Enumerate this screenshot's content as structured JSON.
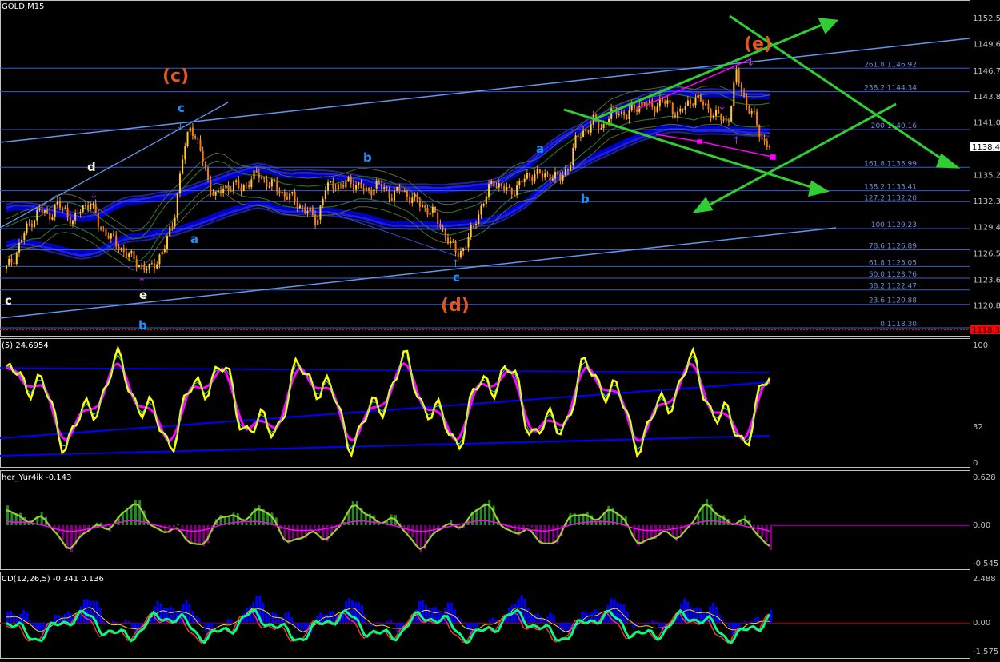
{
  "symbol_label": "GOLD,M15",
  "colors": {
    "background": "#000000",
    "grid_border": "#c0c0c0",
    "fib_line": "#4169e1",
    "trend_line": "#6495ed",
    "channel_green": "#32cd32",
    "triangle_magenta": "#ff00ff",
    "wave_orange": "#e2561f",
    "wave_blue": "#1e90ff",
    "wave_white": "#f5f5dc",
    "price_line": "#ff0000",
    "candle_up": "#ff9900",
    "candle_down": "#ffa040",
    "stoch_main": "#ffff00",
    "stoch_signal": "#ff00ff",
    "osc_pos": "#228b22",
    "osc_neg": "#800080",
    "macd_hist": "#0000ff",
    "macd_line": "#00ff7f"
  },
  "main_panel": {
    "price_axis": [
      "1152.50",
      "1149.65",
      "1146.70",
      "1143.85",
      "1141.00",
      "1138.48",
      "1135.20",
      "1132.30",
      "1129.45",
      "1126.55",
      "1123.65",
      "1120.80",
      "1118.30"
    ],
    "current_price_tag": "1138.48",
    "bottom_price_tag": "1118.30",
    "fib_levels": [
      {
        "label": "261.8 1146.92"
      },
      {
        "label": "238.2 1144.34"
      },
      {
        "label": "200 1140.16"
      },
      {
        "label": "161.8 1135.99"
      },
      {
        "label": "138.2 1133.41"
      },
      {
        "label": "127.2 1132.20"
      },
      {
        "label": "100 1129.23"
      },
      {
        "label": "78.6 1126.89"
      },
      {
        "label": "61.8 1125.05"
      },
      {
        "label": "50.0 1123.76"
      },
      {
        "label": "38.2 1122.47"
      },
      {
        "label": "23.6 1120.88"
      },
      {
        "label": "0 1118.30"
      }
    ],
    "wave_labels": {
      "c_major": "(c)",
      "d_major": "(d)",
      "e_major": "(e)",
      "c_minor_1": "c",
      "d_minor": "d",
      "e_minor": "e",
      "c_minor_white": "c",
      "a_minor_1": "a",
      "b_minor_1": "b",
      "b_minor_2": "b",
      "c_minor_2": "c",
      "a_minor_2": "a",
      "b_minor_3": "b"
    }
  },
  "stoch_panel": {
    "label": "(5) 24.6954",
    "axis": [
      "100",
      "32",
      "0"
    ]
  },
  "osc_panel": {
    "label": "her_Yur4ik -0.143",
    "axis": [
      "0.628",
      "0.00",
      "-0.545"
    ]
  },
  "macd_panel": {
    "label": "CD(12,26,5) -0.341 0.136",
    "axis": [
      "2.488",
      "0.00",
      "-1.575"
    ]
  },
  "chart_data": {
    "type": "line",
    "title": "GOLD,M15",
    "ylim": [
      1118.3,
      1152.5
    ],
    "close_path": [
      1124.8,
      1126.2,
      1128.5,
      1130.1,
      1131.3,
      1130.6,
      1131.8,
      1131.2,
      1130.0,
      1131.5,
      1132.3,
      1129.5,
      1128.8,
      1127.5,
      1126.8,
      1125.9,
      1125.2,
      1124.6,
      1125.8,
      1127.4,
      1130.5,
      1137.0,
      1140.8,
      1138.2,
      1134.5,
      1132.8,
      1133.6,
      1134.2,
      1133.5,
      1134.6,
      1135.2,
      1134.4,
      1133.8,
      1133.1,
      1132.6,
      1131.8,
      1131.0,
      1130.1,
      1133.5,
      1134.2,
      1133.8,
      1134.5,
      1133.9,
      1133.2,
      1134.1,
      1133.6,
      1132.9,
      1133.5,
      1132.8,
      1132.1,
      1131.5,
      1130.8,
      1129.2,
      1127.3,
      1126.5,
      1127.8,
      1130.4,
      1132.3,
      1134.6,
      1133.8,
      1133.2,
      1134.0,
      1134.8,
      1135.4,
      1134.9,
      1135.3,
      1134.6,
      1136.1,
      1139.2,
      1140.1,
      1141.0,
      1140.4,
      1141.8,
      1142.3,
      1141.6,
      1142.7,
      1143.1,
      1142.5,
      1143.4,
      1142.8,
      1141.9,
      1142.6,
      1143.8,
      1143.0,
      1142.2,
      1141.5,
      1140.9,
      1146.3,
      1143.5,
      1141.8,
      1139.2,
      1138.48
    ],
    "fib_levels": [
      {
        "ratio": "261.8",
        "price": 1146.92
      },
      {
        "ratio": "238.2",
        "price": 1144.34
      },
      {
        "ratio": "200",
        "price": 1140.16
      },
      {
        "ratio": "161.8",
        "price": 1135.99
      },
      {
        "ratio": "138.2",
        "price": 1133.41
      },
      {
        "ratio": "127.2",
        "price": 1132.2
      },
      {
        "ratio": "100",
        "price": 1129.23
      },
      {
        "ratio": "78.6",
        "price": 1126.89
      },
      {
        "ratio": "61.8",
        "price": 1125.05
      },
      {
        "ratio": "50.0",
        "price": 1123.76
      },
      {
        "ratio": "38.2",
        "price": 1122.47
      },
      {
        "ratio": "23.6",
        "price": 1120.88
      },
      {
        "ratio": "0",
        "price": 1118.3
      }
    ],
    "indicators": {
      "stochastic": {
        "range": [
          0,
          100
        ],
        "last": 24.6954
      },
      "oscillator": {
        "range": [
          -0.545,
          0.628
        ],
        "last": -0.143
      },
      "macd": {
        "range": [
          -1.575,
          2.488
        ],
        "main": -0.341,
        "signal": 0.136
      }
    }
  }
}
